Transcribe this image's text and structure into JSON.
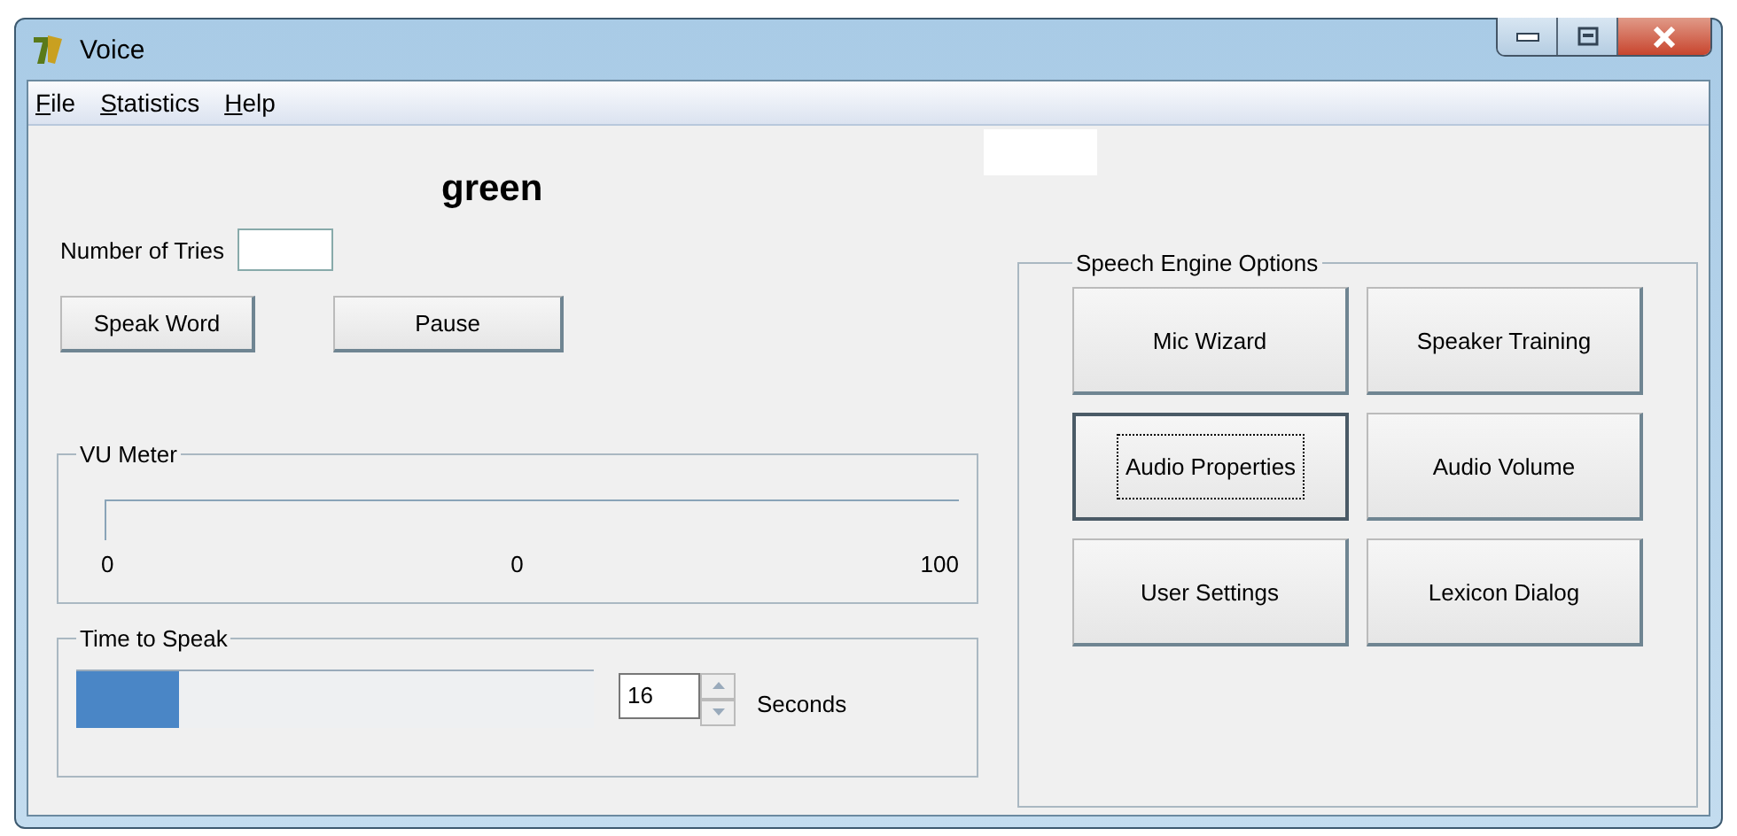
{
  "window": {
    "title": "Voice"
  },
  "menu": [
    {
      "label": "File"
    },
    {
      "label": "Statistics"
    },
    {
      "label": "Help"
    }
  ],
  "word": "green",
  "tries": {
    "label": "Number of Tries"
  },
  "buttons": [
    {
      "label": "Speak Word"
    },
    {
      "label": "Pause"
    }
  ],
  "vu_meter": {
    "title": "VU Meter",
    "scale": [
      "0",
      "0",
      "100"
    ]
  },
  "time_to_speak": {
    "title": "Time to Speak",
    "level": 0.2,
    "value": "16",
    "unit": "Seconds"
  },
  "engine_options": {
    "title": "Speech Engine Options",
    "buttons": [
      {
        "label": "Mic Wizard",
        "focused": false
      },
      {
        "label": "Speaker Training",
        "focused": false
      },
      {
        "label": "Audio Properties",
        "focused": true
      },
      {
        "label": "Audio Volume",
        "focused": false
      },
      {
        "label": "User Settings",
        "focused": false
      },
      {
        "label": "Lexicon Dialog",
        "focused": false
      }
    ]
  }
}
